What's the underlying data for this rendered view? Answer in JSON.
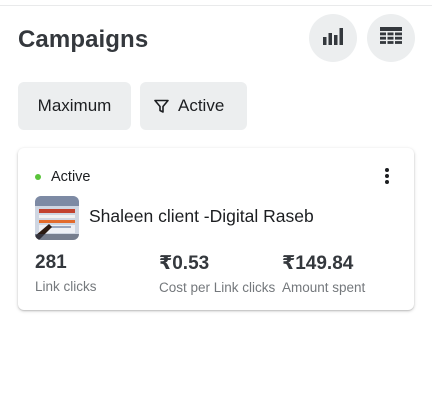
{
  "header": {
    "title": "Campaigns",
    "chart_icon": "bar-chart-icon",
    "table_icon": "table-icon"
  },
  "filters": {
    "maximum_label": "Maximum",
    "active_label": "Active",
    "filter_icon": "filter-icon"
  },
  "campaign": {
    "status": "Active",
    "status_color": "#5ac43a",
    "name": "Shaleen client -Digital Raseb",
    "more_icon": "more-vertical-icon",
    "metrics": [
      {
        "value": "281",
        "label": "Link clicks"
      },
      {
        "value": "₹0.53",
        "label": "Cost per Link clicks"
      },
      {
        "value": "₹149.84",
        "label": "Amount spent"
      }
    ]
  }
}
